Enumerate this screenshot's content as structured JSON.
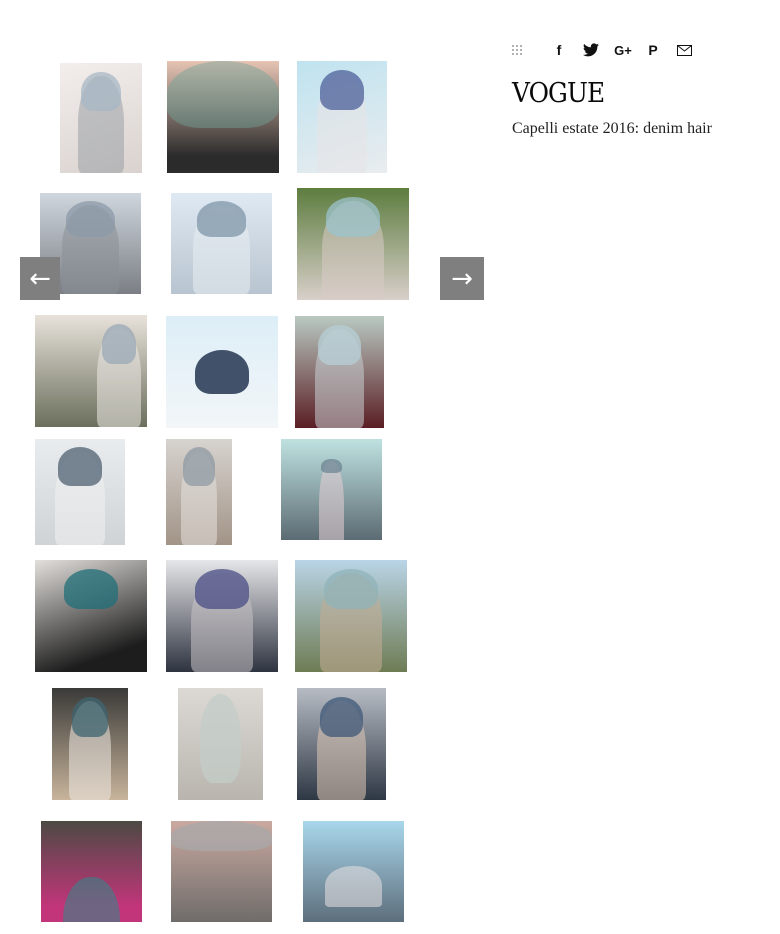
{
  "share": {
    "icons": [
      "grid-icon",
      "facebook-icon",
      "twitter-icon",
      "google-plus-icon",
      "pinterest-icon",
      "mail-icon"
    ],
    "facebook_glyph": "f",
    "googleplus_glyph": "G+",
    "pinterest_glyph": "P"
  },
  "brand": {
    "name": "VOGUE"
  },
  "article": {
    "title": "Capelli estate 2016: denim hair"
  },
  "carousel": {
    "prev_glyph": "←",
    "next_glyph": "→"
  },
  "gallery": {
    "count": 21,
    "palette": [
      "#6f8fa8",
      "#8fb6c2",
      "#4a6d8c",
      "#a9c8d6",
      "#3f5a78",
      "#c9d9e3",
      "#5b7e9e"
    ]
  }
}
